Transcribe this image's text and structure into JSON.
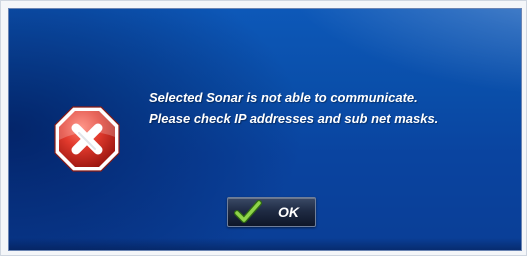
{
  "dialog": {
    "icon": "stop-error-icon",
    "message_line1": "Selected Sonar is not able to communicate.",
    "message_line2": "Please check IP addresses and sub net masks.",
    "ok_button": {
      "label": "OK",
      "icon": "checkmark-icon"
    }
  },
  "colors": {
    "background": "#0a4ea9",
    "icon_red": "#d8322a",
    "check_green": "#7bc63a",
    "text": "#ffffff"
  }
}
